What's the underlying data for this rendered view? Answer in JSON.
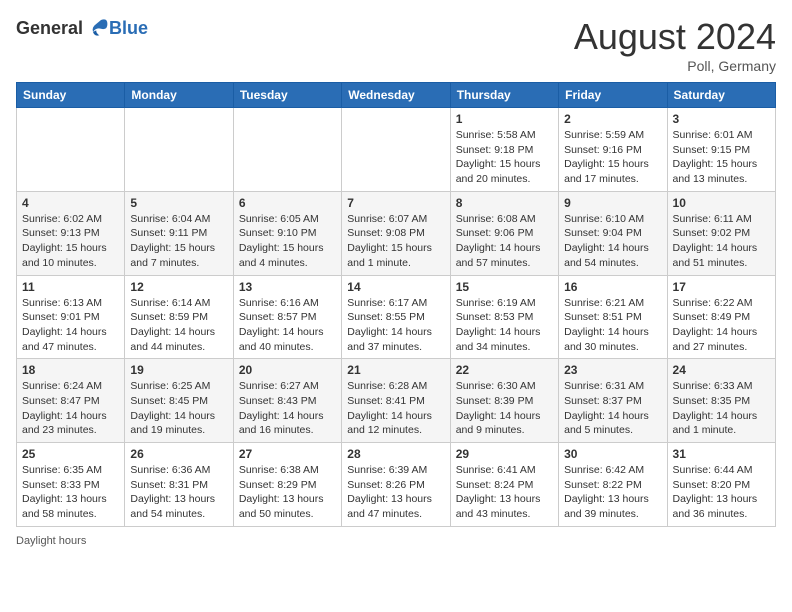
{
  "header": {
    "logo_general": "General",
    "logo_blue": "Blue",
    "month_year": "August 2024",
    "location": "Poll, Germany"
  },
  "days_of_week": [
    "Sunday",
    "Monday",
    "Tuesday",
    "Wednesday",
    "Thursday",
    "Friday",
    "Saturday"
  ],
  "weeks": [
    [
      {
        "day": "",
        "info": ""
      },
      {
        "day": "",
        "info": ""
      },
      {
        "day": "",
        "info": ""
      },
      {
        "day": "",
        "info": ""
      },
      {
        "day": "1",
        "info": "Sunrise: 5:58 AM\nSunset: 9:18 PM\nDaylight: 15 hours\nand 20 minutes."
      },
      {
        "day": "2",
        "info": "Sunrise: 5:59 AM\nSunset: 9:16 PM\nDaylight: 15 hours\nand 17 minutes."
      },
      {
        "day": "3",
        "info": "Sunrise: 6:01 AM\nSunset: 9:15 PM\nDaylight: 15 hours\nand 13 minutes."
      }
    ],
    [
      {
        "day": "4",
        "info": "Sunrise: 6:02 AM\nSunset: 9:13 PM\nDaylight: 15 hours\nand 10 minutes."
      },
      {
        "day": "5",
        "info": "Sunrise: 6:04 AM\nSunset: 9:11 PM\nDaylight: 15 hours\nand 7 minutes."
      },
      {
        "day": "6",
        "info": "Sunrise: 6:05 AM\nSunset: 9:10 PM\nDaylight: 15 hours\nand 4 minutes."
      },
      {
        "day": "7",
        "info": "Sunrise: 6:07 AM\nSunset: 9:08 PM\nDaylight: 15 hours\nand 1 minute."
      },
      {
        "day": "8",
        "info": "Sunrise: 6:08 AM\nSunset: 9:06 PM\nDaylight: 14 hours\nand 57 minutes."
      },
      {
        "day": "9",
        "info": "Sunrise: 6:10 AM\nSunset: 9:04 PM\nDaylight: 14 hours\nand 54 minutes."
      },
      {
        "day": "10",
        "info": "Sunrise: 6:11 AM\nSunset: 9:02 PM\nDaylight: 14 hours\nand 51 minutes."
      }
    ],
    [
      {
        "day": "11",
        "info": "Sunrise: 6:13 AM\nSunset: 9:01 PM\nDaylight: 14 hours\nand 47 minutes."
      },
      {
        "day": "12",
        "info": "Sunrise: 6:14 AM\nSunset: 8:59 PM\nDaylight: 14 hours\nand 44 minutes."
      },
      {
        "day": "13",
        "info": "Sunrise: 6:16 AM\nSunset: 8:57 PM\nDaylight: 14 hours\nand 40 minutes."
      },
      {
        "day": "14",
        "info": "Sunrise: 6:17 AM\nSunset: 8:55 PM\nDaylight: 14 hours\nand 37 minutes."
      },
      {
        "day": "15",
        "info": "Sunrise: 6:19 AM\nSunset: 8:53 PM\nDaylight: 14 hours\nand 34 minutes."
      },
      {
        "day": "16",
        "info": "Sunrise: 6:21 AM\nSunset: 8:51 PM\nDaylight: 14 hours\nand 30 minutes."
      },
      {
        "day": "17",
        "info": "Sunrise: 6:22 AM\nSunset: 8:49 PM\nDaylight: 14 hours\nand 27 minutes."
      }
    ],
    [
      {
        "day": "18",
        "info": "Sunrise: 6:24 AM\nSunset: 8:47 PM\nDaylight: 14 hours\nand 23 minutes."
      },
      {
        "day": "19",
        "info": "Sunrise: 6:25 AM\nSunset: 8:45 PM\nDaylight: 14 hours\nand 19 minutes."
      },
      {
        "day": "20",
        "info": "Sunrise: 6:27 AM\nSunset: 8:43 PM\nDaylight: 14 hours\nand 16 minutes."
      },
      {
        "day": "21",
        "info": "Sunrise: 6:28 AM\nSunset: 8:41 PM\nDaylight: 14 hours\nand 12 minutes."
      },
      {
        "day": "22",
        "info": "Sunrise: 6:30 AM\nSunset: 8:39 PM\nDaylight: 14 hours\nand 9 minutes."
      },
      {
        "day": "23",
        "info": "Sunrise: 6:31 AM\nSunset: 8:37 PM\nDaylight: 14 hours\nand 5 minutes."
      },
      {
        "day": "24",
        "info": "Sunrise: 6:33 AM\nSunset: 8:35 PM\nDaylight: 14 hours\nand 1 minute."
      }
    ],
    [
      {
        "day": "25",
        "info": "Sunrise: 6:35 AM\nSunset: 8:33 PM\nDaylight: 13 hours\nand 58 minutes."
      },
      {
        "day": "26",
        "info": "Sunrise: 6:36 AM\nSunset: 8:31 PM\nDaylight: 13 hours\nand 54 minutes."
      },
      {
        "day": "27",
        "info": "Sunrise: 6:38 AM\nSunset: 8:29 PM\nDaylight: 13 hours\nand 50 minutes."
      },
      {
        "day": "28",
        "info": "Sunrise: 6:39 AM\nSunset: 8:26 PM\nDaylight: 13 hours\nand 47 minutes."
      },
      {
        "day": "29",
        "info": "Sunrise: 6:41 AM\nSunset: 8:24 PM\nDaylight: 13 hours\nand 43 minutes."
      },
      {
        "day": "30",
        "info": "Sunrise: 6:42 AM\nSunset: 8:22 PM\nDaylight: 13 hours\nand 39 minutes."
      },
      {
        "day": "31",
        "info": "Sunrise: 6:44 AM\nSunset: 8:20 PM\nDaylight: 13 hours\nand 36 minutes."
      }
    ]
  ],
  "footer": {
    "daylight_label": "Daylight hours"
  }
}
